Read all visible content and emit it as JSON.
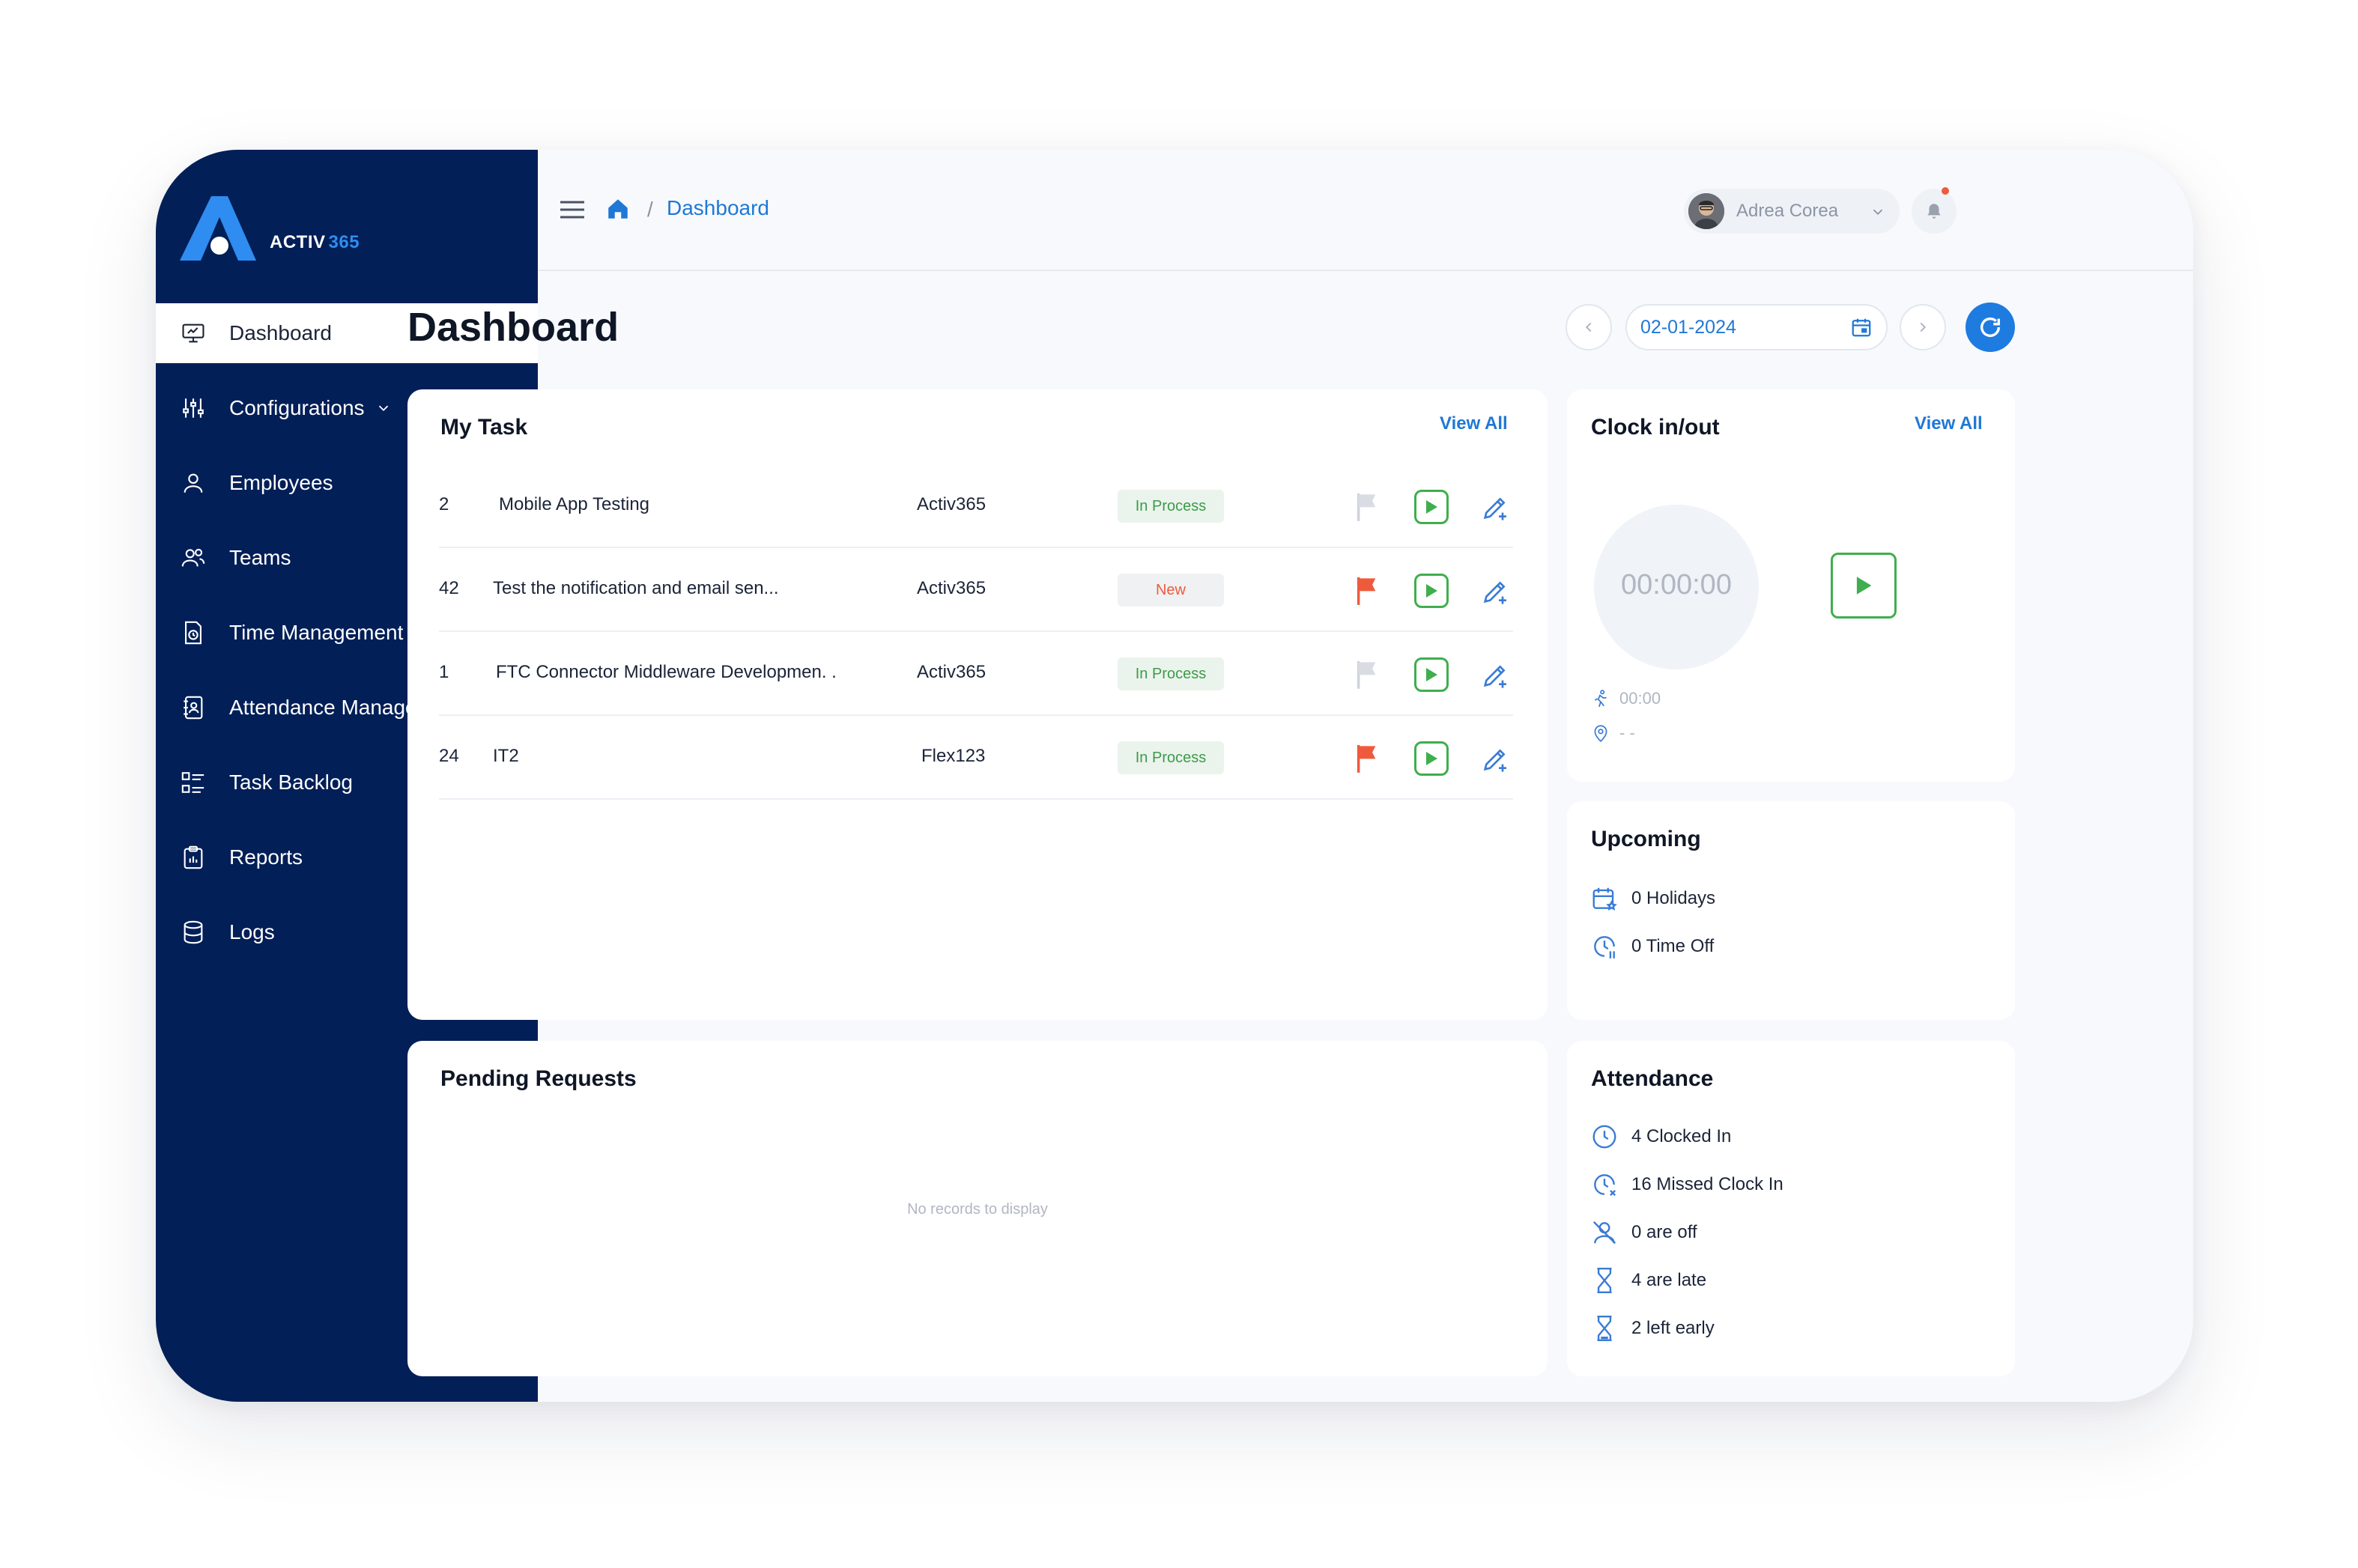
{
  "brand": {
    "name": "ACTIV",
    "number": "365",
    "accent": "#2f8cf0",
    "sidebar_bg": "#021f57"
  },
  "sidebar": {
    "items": [
      {
        "label": "Dashboard",
        "icon": "monitor-icon",
        "active": true
      },
      {
        "label": "Configurations",
        "icon": "sliders-icon",
        "expandable": true
      },
      {
        "label": "Employees",
        "icon": "user-icon"
      },
      {
        "label": "Teams",
        "icon": "users-icon"
      },
      {
        "label": "Time Management",
        "icon": "time-document-icon",
        "expandable": true
      },
      {
        "label": "Attendance Management",
        "icon": "attendance-book-icon",
        "expandable": true
      },
      {
        "label": "Task Backlog",
        "icon": "task-list-icon"
      },
      {
        "label": "Reports",
        "icon": "clipboard-icon"
      },
      {
        "label": "Logs",
        "icon": "database-icon"
      }
    ]
  },
  "topbar": {
    "breadcrumb": {
      "separator": "/",
      "current": "Dashboard"
    },
    "user": {
      "name": "Adrea Corea"
    }
  },
  "header": {
    "title": "Dashboard",
    "date": "02-01-2024"
  },
  "my_task": {
    "title": "My Task",
    "view_all": "View All",
    "rows": [
      {
        "id": "2",
        "name": "Mobile App Testing",
        "project": "Activ365",
        "status": "In Process",
        "flagged": false
      },
      {
        "id": "42",
        "name": "Test the notification and email sen...",
        "project": "Activ365",
        "status": "New",
        "flagged": true
      },
      {
        "id": "1",
        "name": "FTC Connector Middleware Developmen. .",
        "project": "Activ365",
        "status": "In Process",
        "flagged": false
      },
      {
        "id": "24",
        "name": "IT2",
        "project": "Flex123",
        "status": "In Process",
        "flagged": true
      }
    ]
  },
  "clock": {
    "title": "Clock in/out",
    "view_all": "View All",
    "timer": "00:00:00",
    "duration": "00:00",
    "location": "- -"
  },
  "upcoming": {
    "title": "Upcoming",
    "items": [
      {
        "text": "0 Holidays",
        "icon": "calendar-star-icon"
      },
      {
        "text": "0 Time Off",
        "icon": "clock-pause-icon"
      }
    ]
  },
  "pending": {
    "title": "Pending Requests",
    "empty": "No records to display"
  },
  "attendance": {
    "title": "Attendance",
    "items": [
      {
        "text": "4 Clocked In",
        "icon": "clock-icon"
      },
      {
        "text": "16 Missed Clock In",
        "icon": "clock-missed-icon"
      },
      {
        "text": "0 are off",
        "icon": "user-off-icon"
      },
      {
        "text": "4 are late",
        "icon": "hourglass-icon"
      },
      {
        "text": "2 left early",
        "icon": "hourglass-empty-icon"
      }
    ]
  },
  "colors": {
    "primary": "#1f78d6",
    "success": "#3fae4d",
    "danger": "#ef5a3c"
  }
}
